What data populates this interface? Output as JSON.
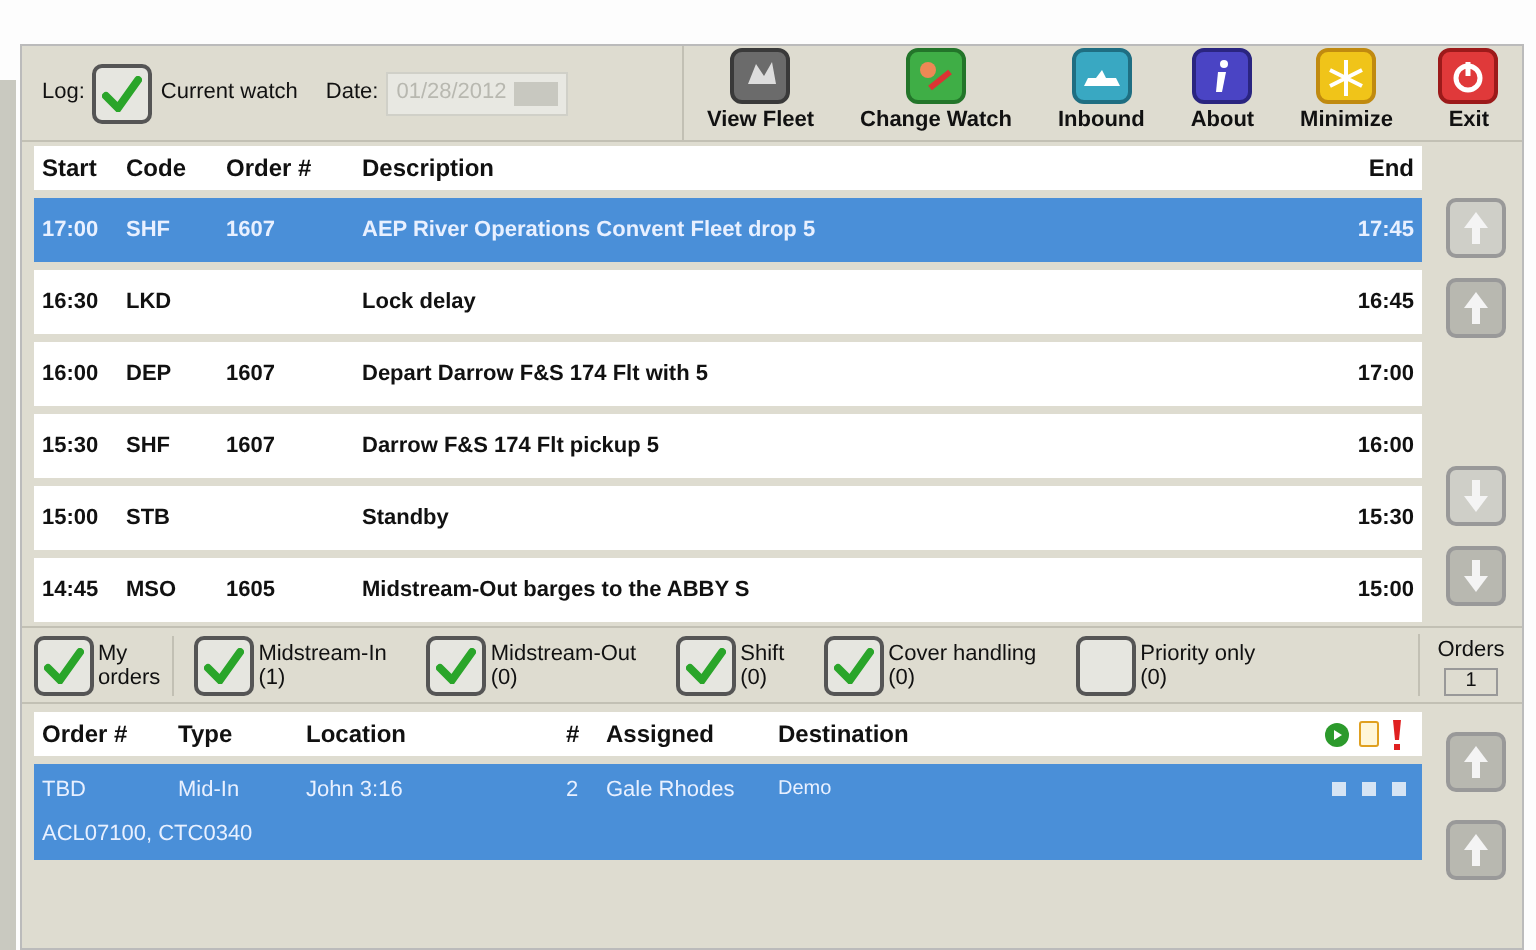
{
  "log": {
    "label": "Log:",
    "current_watch": {
      "label": "Current watch",
      "checked": true
    },
    "date": {
      "label": "Date:",
      "value": "01/28/2012",
      "disabled": true
    }
  },
  "toolbar": [
    {
      "kind": "fleet",
      "label": "View Fleet"
    },
    {
      "kind": "watch",
      "label": "Change Watch"
    },
    {
      "kind": "inbound",
      "label": "Inbound"
    },
    {
      "kind": "about",
      "label": "About"
    },
    {
      "kind": "minimize",
      "label": "Minimize"
    },
    {
      "kind": "exit",
      "label": "Exit"
    }
  ],
  "log_table": {
    "columns": [
      "Start",
      "Code",
      "Order #",
      "Description",
      "End"
    ],
    "rows": [
      {
        "cells": [
          "17:00",
          "SHF",
          "1607",
          "AEP River Operations Convent Fleet drop 5",
          "17:45"
        ],
        "selected": true
      },
      {
        "cells": [
          "16:30",
          "LKD",
          "",
          "Lock delay",
          "16:45"
        ],
        "selected": false
      },
      {
        "cells": [
          "16:00",
          "DEP",
          "1607",
          "Depart Darrow F&S 174 Flt with 5",
          "17:00"
        ],
        "selected": false
      },
      {
        "cells": [
          "15:30",
          "SHF",
          "1607",
          "Darrow F&S 174 Flt pickup 5",
          "16:00"
        ],
        "selected": false
      },
      {
        "cells": [
          "15:00",
          "STB",
          "",
          "Standby",
          "15:30"
        ],
        "selected": false
      },
      {
        "cells": [
          "14:45",
          "MSO",
          "1605",
          "Midstream-Out barges to the ABBY S",
          "15:00"
        ],
        "selected": false
      }
    ]
  },
  "filters": [
    {
      "label": "My",
      "count": "orders",
      "checked": true
    },
    {
      "label": "Midstream-In",
      "count": "(1)",
      "checked": true
    },
    {
      "label": "Midstream-Out",
      "count": "(0)",
      "checked": true
    },
    {
      "label": "Shift",
      "count": "(0)",
      "checked": true
    },
    {
      "label": "Cover handling",
      "count": "(0)",
      "checked": true
    },
    {
      "label": "Priority only",
      "count": "(0)",
      "checked": false
    }
  ],
  "orders_count": {
    "label": "Orders",
    "value": "1"
  },
  "orders_table": {
    "columns": [
      "Order #",
      "Type",
      "Location",
      "#",
      "Assigned",
      "Destination"
    ],
    "rows": [
      {
        "cells": [
          "TBD",
          "Mid-In",
          "John 3:16",
          "2",
          "Gale Rhodes",
          "Demo"
        ],
        "barges": "ACL07100, CTC0340",
        "selected": true
      }
    ]
  }
}
